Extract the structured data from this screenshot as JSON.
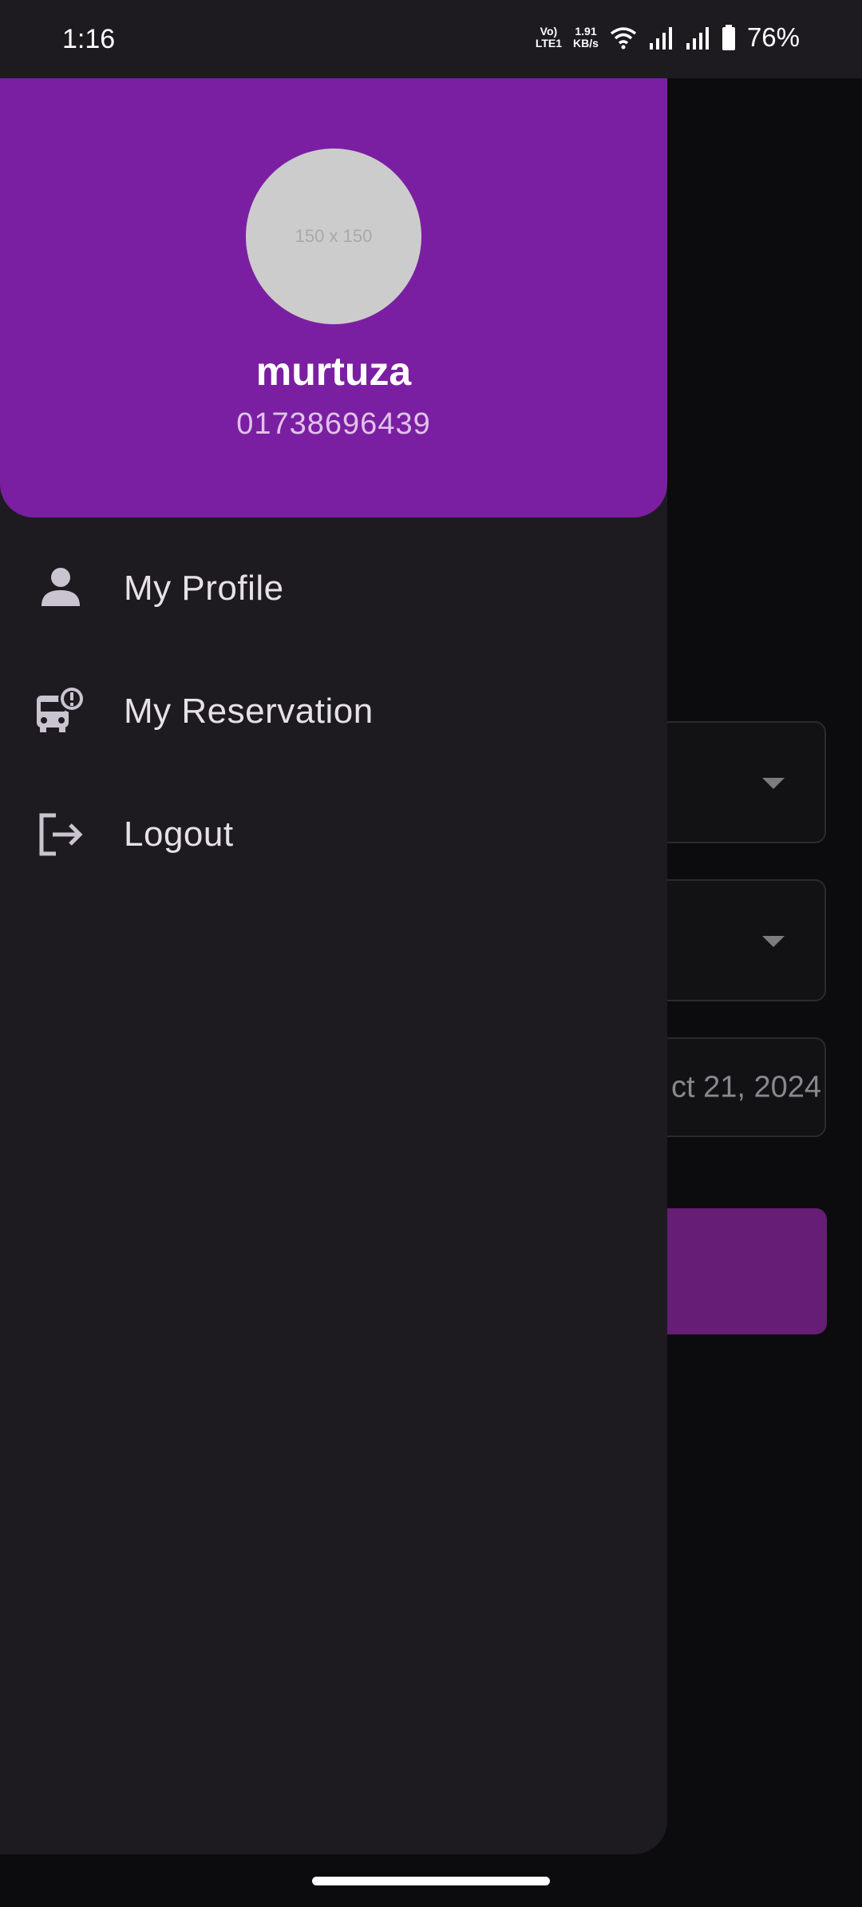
{
  "status_bar": {
    "time": "1:16",
    "volte_top": "Vo)",
    "volte_bottom": "LTE1",
    "speed_value": "1.91",
    "speed_unit": "KB/s",
    "battery_percent": "76%"
  },
  "drawer": {
    "avatar_placeholder": "150 x 150",
    "user_name": "murtuza",
    "user_phone": "01738696439",
    "menu": [
      {
        "label": "My Profile",
        "icon": "person-icon"
      },
      {
        "label": "My Reservation",
        "icon": "bus-alert-icon"
      },
      {
        "label": "Logout",
        "icon": "logout-icon"
      }
    ]
  },
  "background_page": {
    "date_value": "ct 21, 2024"
  },
  "colors": {
    "drawer_header": "#7b1fa2",
    "drawer_bg": "#1d1b20",
    "background_button": "#661d75"
  }
}
